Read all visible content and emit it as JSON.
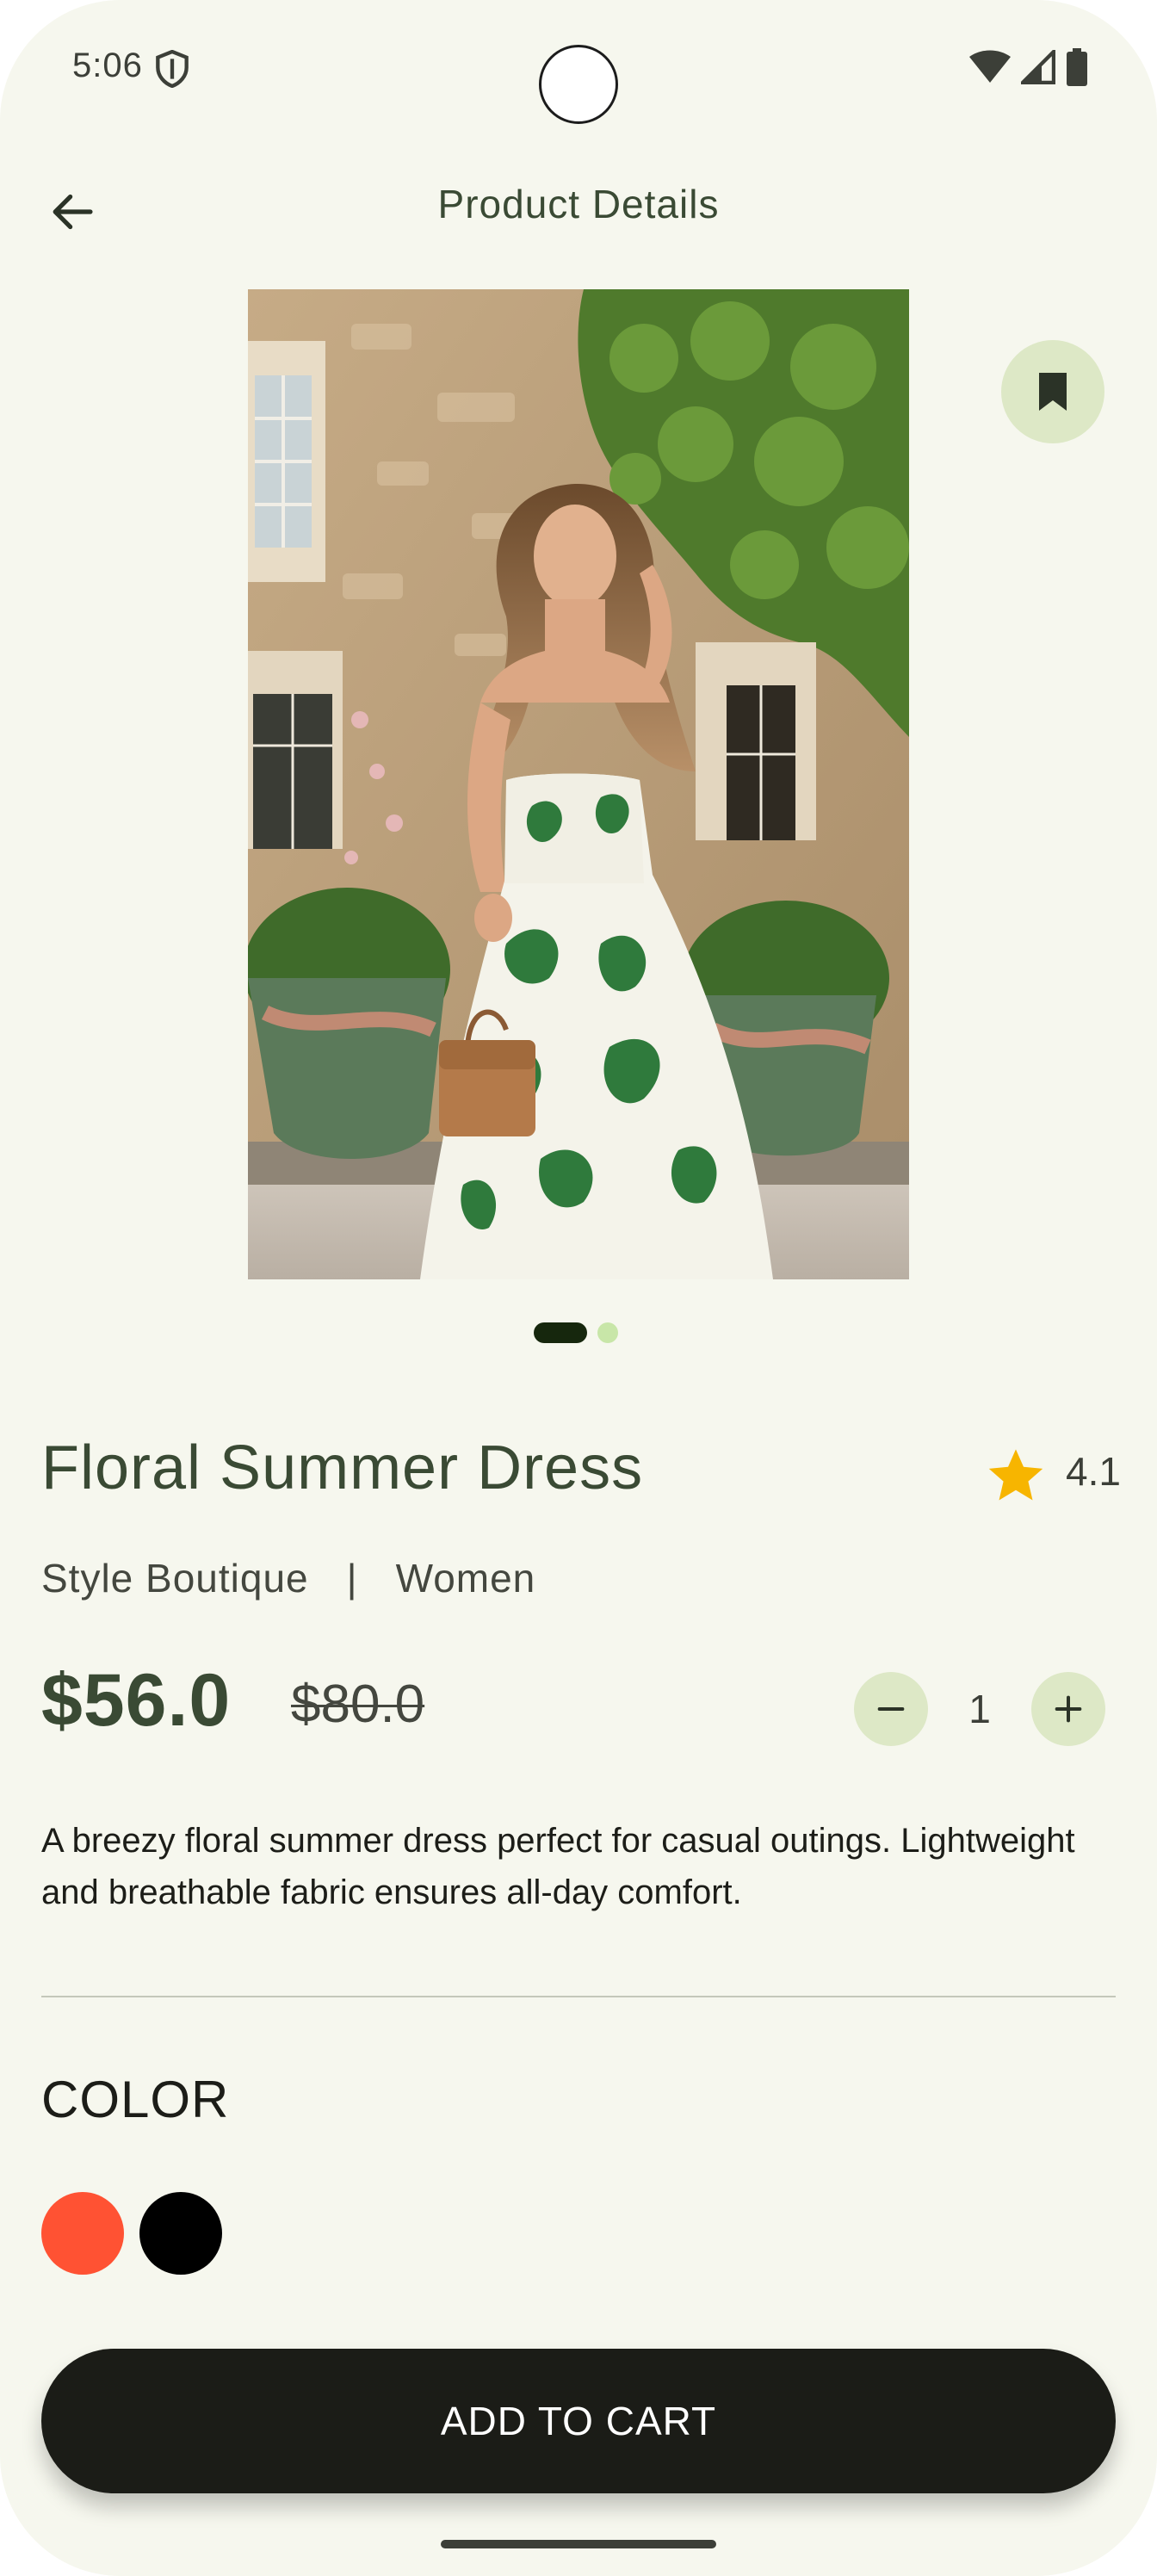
{
  "status_bar": {
    "time": "5:06",
    "icons": [
      "shield-icon",
      "wifi-icon",
      "signal-icon",
      "battery-icon"
    ]
  },
  "app_bar": {
    "title": "Product Details",
    "back_icon": "arrow-back-icon"
  },
  "gallery": {
    "image_description_icon": "bookmark-icon",
    "page_count": 2,
    "current_page": 1
  },
  "product": {
    "name": "Floral Summer Dress",
    "rating": "4.1",
    "brand": "Style Boutique",
    "separator": "|",
    "category": "Women",
    "price": "$56.0",
    "original_price": "$80.0",
    "quantity": "1",
    "description": "A breezy floral summer dress perfect for casual outings. Lightweight and breathable fabric ensures all-day comfort."
  },
  "color_section": {
    "heading": "COLOR",
    "options": [
      {
        "name": "orange",
        "hex": "#ff5233"
      },
      {
        "name": "black",
        "hex": "#000000"
      }
    ]
  },
  "cart": {
    "button_label": "ADD TO CART"
  },
  "colors": {
    "background": "#f6f7ee",
    "accent_soft": "#dde8c6",
    "dark": "#1b1c17",
    "title_green": "#3a4a34",
    "star": "#f7b500"
  }
}
